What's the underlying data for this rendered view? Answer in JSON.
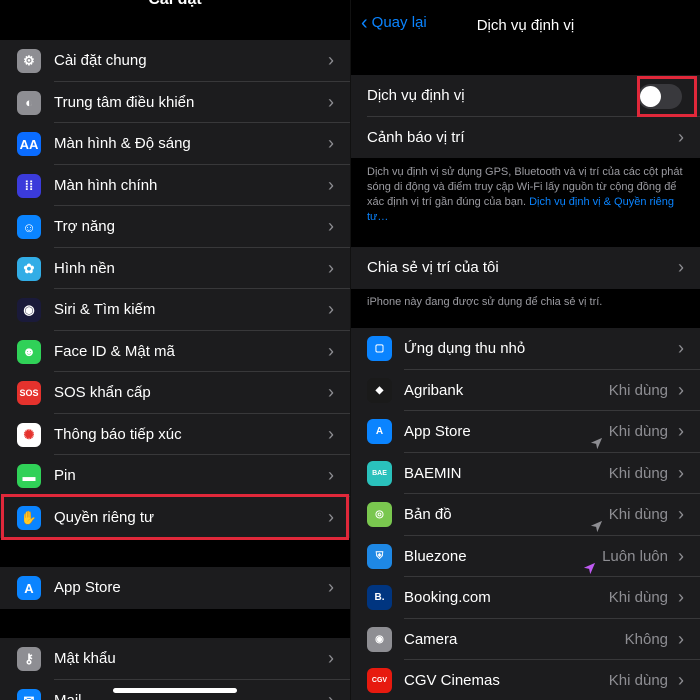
{
  "left": {
    "title": "Cài đặt",
    "group1": [
      {
        "label": "Cài đặt chung",
        "icon": "gear-icon",
        "color": "#8e8e93",
        "glyph": "⚙"
      },
      {
        "label": "Trung tâm điều khiển",
        "icon": "control-center-icon",
        "color": "#8e8e93",
        "glyph": "◐"
      },
      {
        "label": "Màn hình & Độ sáng",
        "icon": "display-brightness-icon",
        "color": "#0a6cff",
        "glyph": "AA"
      },
      {
        "label": "Màn hình chính",
        "icon": "home-screen-icon",
        "color": "#3b3bdb",
        "glyph": "⁞⁞"
      },
      {
        "label": "Trợ năng",
        "icon": "accessibility-icon",
        "color": "#0a84ff",
        "glyph": "☺"
      },
      {
        "label": "Hình nền",
        "icon": "wallpaper-icon",
        "color": "#32ade6",
        "glyph": "✿"
      },
      {
        "label": "Siri & Tìm kiếm",
        "icon": "siri-icon",
        "color": "#1a1a3a",
        "glyph": "◉"
      },
      {
        "label": "Face ID & Mật mã",
        "icon": "face-id-icon",
        "color": "#30d158",
        "glyph": "☻"
      },
      {
        "label": "SOS khẩn cấp",
        "icon": "sos-icon",
        "color": "#e5322d",
        "glyph": "SOS"
      },
      {
        "label": "Thông báo tiếp xúc",
        "icon": "exposure-notification-icon",
        "color": "#ffffff",
        "glyph": "✺"
      },
      {
        "label": "Pin",
        "icon": "battery-icon",
        "color": "#30d158",
        "glyph": "▬"
      },
      {
        "label": "Quyền riêng tư",
        "icon": "privacy-hand-icon",
        "color": "#0a84ff",
        "glyph": "✋"
      }
    ],
    "group2": [
      {
        "label": "App Store",
        "icon": "app-store-icon",
        "color": "#0a84ff",
        "glyph": "A"
      }
    ],
    "group3": [
      {
        "label": "Mật khẩu",
        "icon": "key-icon",
        "color": "#8e8e93",
        "glyph": "⚷"
      },
      {
        "label": "Mail",
        "icon": "mail-icon",
        "color": "#0a84ff",
        "glyph": "✉"
      }
    ]
  },
  "right": {
    "back_label": "Quay lại",
    "title": "Dịch vụ định vị",
    "location_services_label": "Dịch vụ định vị",
    "location_services_on": false,
    "location_alerts_label": "Cảnh báo vị trí",
    "footnote_text": "Dịch vụ định vị sử dụng GPS, Bluetooth và vị trí của các cột phát sóng di động và điểm truy cập Wi-Fi lấy nguồn từ cộng đồng để xác định vị trí gần đúng của bạn.",
    "footnote_link": "Dịch vụ định vị & Quyền riêng tư…",
    "share_label": "Chia sẻ vị trí của tôi",
    "share_note": "iPhone này đang được sử dụng để chia sẻ vị trí.",
    "apps": [
      {
        "label": "Ứng dụng thu nhỏ",
        "icon": "app-clips-icon",
        "color": "#0a84ff",
        "glyph": "▢",
        "value": "",
        "arrow": ""
      },
      {
        "label": "Agribank",
        "icon": "agribank-icon",
        "color": "#1a1a1a",
        "glyph": "◆",
        "value": "Khi dùng",
        "arrow": ""
      },
      {
        "label": "App Store",
        "icon": "app-store-icon",
        "color": "#0a84ff",
        "glyph": "A",
        "value": "Khi dùng",
        "arrow": "gray"
      },
      {
        "label": "BAEMIN",
        "icon": "baemin-icon",
        "color": "#2ac1bc",
        "glyph": "BAE",
        "value": "Khi dùng",
        "arrow": ""
      },
      {
        "label": "Bản đồ",
        "icon": "maps-icon",
        "color": "#7ac74f",
        "glyph": "◎",
        "value": "Khi dùng",
        "arrow": "gray"
      },
      {
        "label": "Bluezone",
        "icon": "bluezone-icon",
        "color": "#1e88e5",
        "glyph": "⛨",
        "value": "Luôn luôn",
        "arrow": "purple"
      },
      {
        "label": "Booking.com",
        "icon": "booking-icon",
        "color": "#003580",
        "glyph": "B.",
        "value": "Khi dùng",
        "arrow": ""
      },
      {
        "label": "Camera",
        "icon": "camera-icon",
        "color": "#8e8e93",
        "glyph": "◉",
        "value": "Không",
        "arrow": ""
      },
      {
        "label": "CGV Cinemas",
        "icon": "cgv-icon",
        "color": "#e71a0f",
        "glyph": "CGV",
        "value": "Khi dùng",
        "arrow": ""
      }
    ]
  }
}
